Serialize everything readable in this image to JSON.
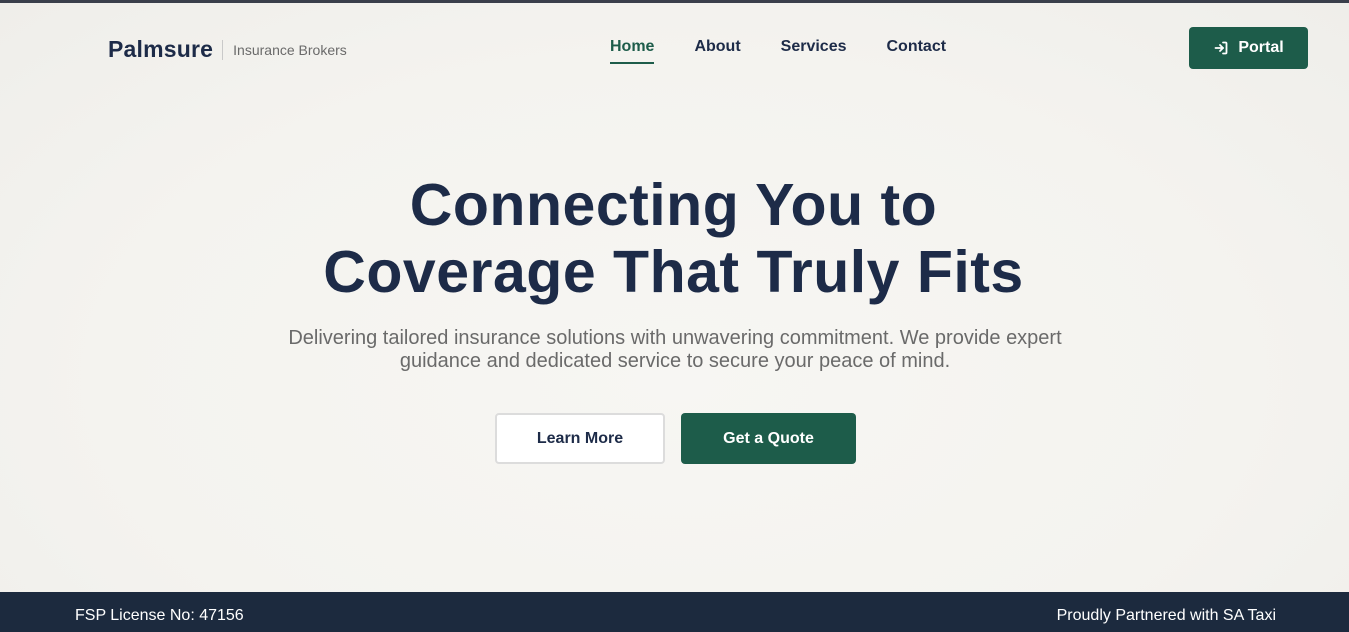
{
  "brand": {
    "name": "Palmsure",
    "tagline": "Insurance Brokers"
  },
  "nav": {
    "items": [
      {
        "label": "Home",
        "active": true
      },
      {
        "label": "About",
        "active": false
      },
      {
        "label": "Services",
        "active": false
      },
      {
        "label": "Contact",
        "active": false
      }
    ]
  },
  "portal": {
    "label": "Portal",
    "icon": "login-icon"
  },
  "hero": {
    "title_line1": "Connecting You to",
    "title_line2": "Coverage That Truly Fits",
    "subtitle": "Delivering tailored insurance solutions with unwavering commitment. We provide expert guidance and dedicated service to secure your peace of mind.",
    "learn_more_label": "Learn More",
    "quote_label": "Get a Quote"
  },
  "footer": {
    "license": "FSP License No: 47156",
    "partner": "Proudly Partnered with SA Taxi"
  },
  "colors": {
    "primary": "#1d5c4a",
    "navy": "#1d2b48",
    "footer_bg": "#1c2a3e",
    "background": "#f6f4f1"
  }
}
